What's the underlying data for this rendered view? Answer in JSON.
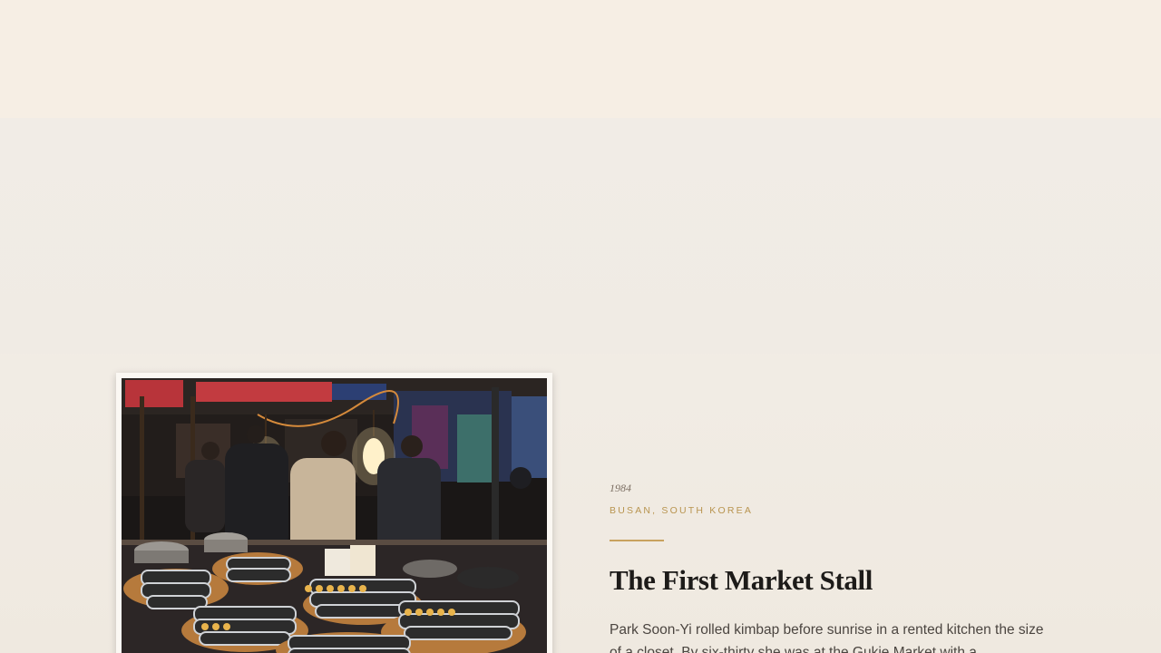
{
  "story": {
    "era": "1984",
    "place": "BUSAN, SOUTH KOREA",
    "title": "The First Market Stall",
    "body": "Park Soon-Yi rolled kimbap before sunrise in a rented kitchen the size of a closet. By six-thirty she was at the Gukje Market with a"
  },
  "photo": {
    "subject": "night market kimbap stall with rolls on trays under hanging bulbs"
  },
  "colors": {
    "background": "#f2ede6",
    "accent": "#c8a25e",
    "place_text": "#b8944f",
    "headline": "#1d1b19",
    "body": "#4b4540"
  }
}
